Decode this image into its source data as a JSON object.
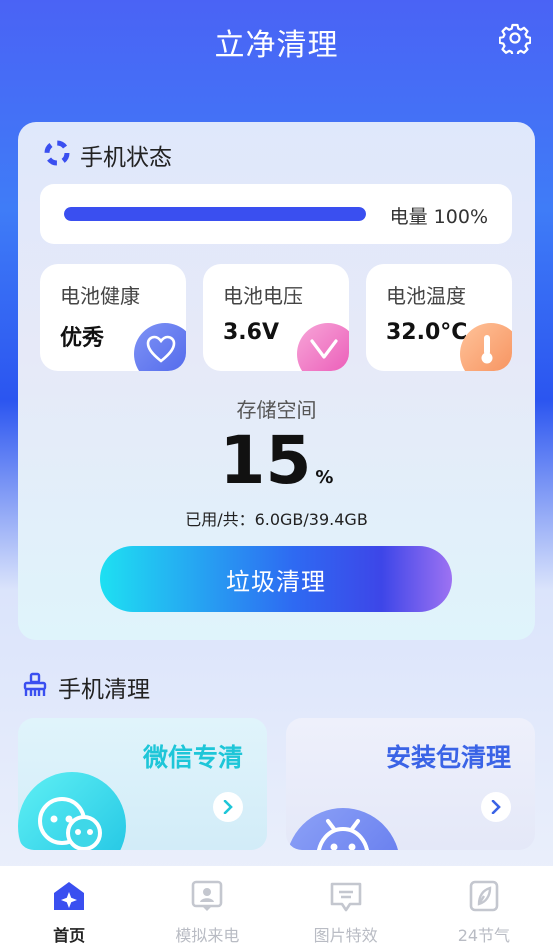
{
  "header": {
    "title": "立净清理"
  },
  "status": {
    "title": "手机状态",
    "battery_text": "电量 100%",
    "battery_level": 1.0,
    "cards": [
      {
        "label": "电池健康",
        "value": "优秀",
        "icon": "heart-icon"
      },
      {
        "label": "电池电压",
        "value": "3.6V",
        "icon": "check-icon"
      },
      {
        "label": "电池温度",
        "value": "32.0°C",
        "icon": "thermometer-icon"
      }
    ],
    "storage_label": "存储空间",
    "storage_percent": "15",
    "storage_unit": "%",
    "storage_used": "已用/共：6.0GB/39.4GB",
    "clean_button": "垃圾清理"
  },
  "phone_clean": {
    "title": "手机清理",
    "features": [
      {
        "title": "微信专清",
        "color": "#1ec6d8",
        "icon": "wechat-icon"
      },
      {
        "title": "安装包清理",
        "color": "#3a63e6",
        "icon": "android-icon"
      }
    ]
  },
  "nav": {
    "items": [
      {
        "label": "首页",
        "icon": "home-icon"
      },
      {
        "label": "模拟来电",
        "icon": "contact-icon"
      },
      {
        "label": "图片特效",
        "icon": "image-effect-icon"
      },
      {
        "label": "24节气",
        "icon": "leaf-icon"
      }
    ]
  },
  "colors": {
    "accent": "#3a4ff0",
    "wechat": "#1ec6d8",
    "apk": "#3a63e6"
  }
}
